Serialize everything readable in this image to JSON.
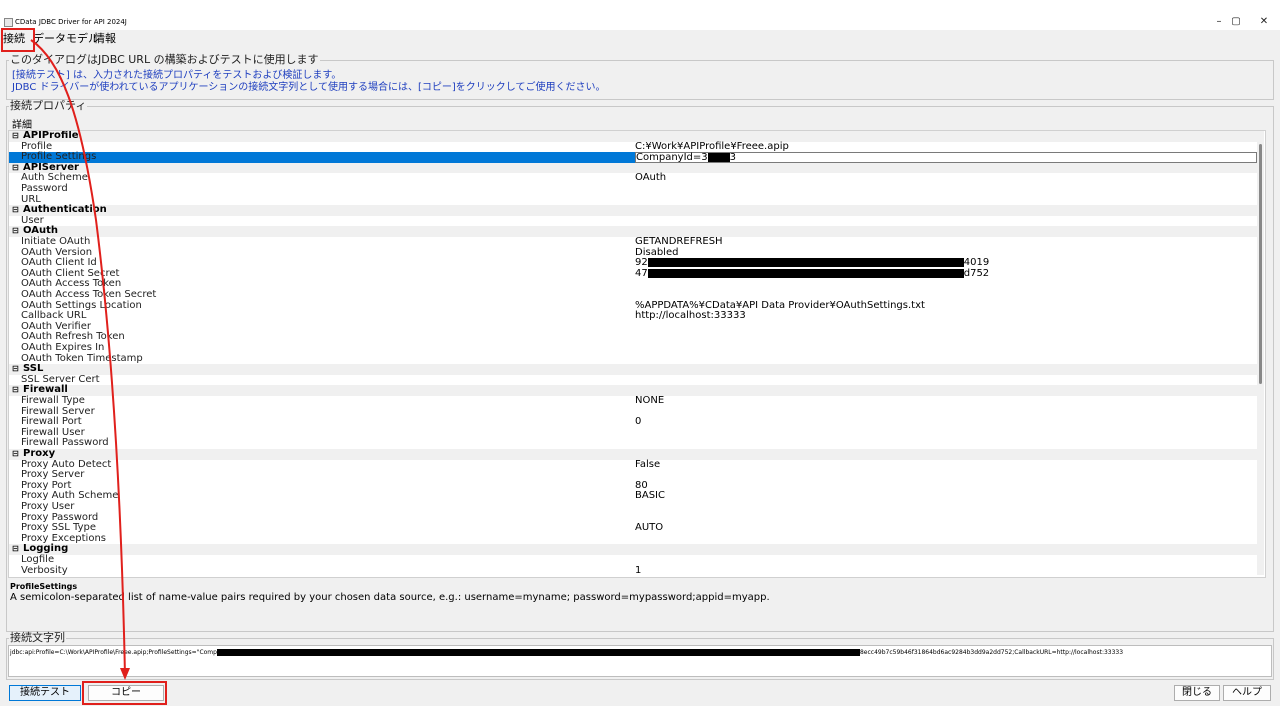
{
  "window": {
    "title": "CData JDBC Driver for API 2024J",
    "controls": {
      "minimize": "–",
      "maximize": "▢",
      "close": "✕"
    }
  },
  "menu": {
    "items": [
      "接続",
      "データモデル",
      "情報"
    ]
  },
  "intro": {
    "legend": "このダイアログはJDBC URL の構築およびテストに使用します",
    "line1": "[接続テスト] は、入力された接続プロパティをテストおよび検証します。",
    "line2": "JDBC ドライバーが使われているアプリケーションの接続文字列として使用する場合には、[コピー]をクリックしてご使用ください。"
  },
  "properties": {
    "legend": "接続プロパティ",
    "details_label": "詳細",
    "rows": [
      {
        "type": "cat",
        "label": "APIProfile"
      },
      {
        "type": "prop",
        "label": "Profile",
        "value": "C:¥Work¥APIProfile¥Freee.apip"
      },
      {
        "type": "prop",
        "label": "Profile Settings",
        "value": "CompanyId=3",
        "value_tail": "3",
        "redact": [
          [
            64,
            22
          ]
        ],
        "selected": true
      },
      {
        "type": "cat",
        "label": "APIServer"
      },
      {
        "type": "prop",
        "label": "Auth Scheme",
        "value": "OAuth"
      },
      {
        "type": "prop",
        "label": "Password",
        "value": ""
      },
      {
        "type": "prop",
        "label": "URL",
        "value": ""
      },
      {
        "type": "cat",
        "label": "Authentication"
      },
      {
        "type": "prop",
        "label": "User",
        "value": ""
      },
      {
        "type": "cat",
        "label": "OAuth"
      },
      {
        "type": "prop",
        "label": "Initiate OAuth",
        "value": "GETANDREFRESH"
      },
      {
        "type": "prop",
        "label": "OAuth Version",
        "value": "Disabled"
      },
      {
        "type": "prop",
        "label": "OAuth Client Id",
        "value": "92",
        "value_tail": "4019",
        "redact": [
          [
            18,
            316
          ]
        ]
      },
      {
        "type": "prop",
        "label": "OAuth Client Secret",
        "value": "47",
        "value_tail": "d752",
        "redact": [
          [
            18,
            316
          ]
        ]
      },
      {
        "type": "prop",
        "label": "OAuth Access Token",
        "value": ""
      },
      {
        "type": "prop",
        "label": "OAuth Access Token Secret",
        "value": ""
      },
      {
        "type": "prop",
        "label": "OAuth Settings Location",
        "value": "%APPDATA%¥CData¥API Data Provider¥OAuthSettings.txt"
      },
      {
        "type": "prop",
        "label": "Callback URL",
        "value": "http://localhost:33333"
      },
      {
        "type": "prop",
        "label": "OAuth Verifier",
        "value": ""
      },
      {
        "type": "prop",
        "label": "OAuth Refresh Token",
        "value": ""
      },
      {
        "type": "prop",
        "label": "OAuth Expires In",
        "value": ""
      },
      {
        "type": "prop",
        "label": "OAuth Token Timestamp",
        "value": ""
      },
      {
        "type": "cat",
        "label": "SSL"
      },
      {
        "type": "prop",
        "label": "SSL Server Cert",
        "value": ""
      },
      {
        "type": "cat",
        "label": "Firewall"
      },
      {
        "type": "prop",
        "label": "Firewall Type",
        "value": "NONE"
      },
      {
        "type": "prop",
        "label": "Firewall Server",
        "value": ""
      },
      {
        "type": "prop",
        "label": "Firewall Port",
        "value": "0"
      },
      {
        "type": "prop",
        "label": "Firewall User",
        "value": ""
      },
      {
        "type": "prop",
        "label": "Firewall Password",
        "value": ""
      },
      {
        "type": "cat",
        "label": "Proxy"
      },
      {
        "type": "prop",
        "label": "Proxy Auto Detect",
        "value": "False"
      },
      {
        "type": "prop",
        "label": "Proxy Server",
        "value": ""
      },
      {
        "type": "prop",
        "label": "Proxy Port",
        "value": "80"
      },
      {
        "type": "prop",
        "label": "Proxy Auth Scheme",
        "value": "BASIC"
      },
      {
        "type": "prop",
        "label": "Proxy User",
        "value": ""
      },
      {
        "type": "prop",
        "label": "Proxy Password",
        "value": ""
      },
      {
        "type": "prop",
        "label": "Proxy SSL Type",
        "value": "AUTO"
      },
      {
        "type": "prop",
        "label": "Proxy Exceptions",
        "value": ""
      },
      {
        "type": "cat",
        "label": "Logging"
      },
      {
        "type": "prop",
        "label": "Logfile",
        "value": ""
      },
      {
        "type": "prop",
        "label": "Verbosity",
        "value": "1"
      }
    ]
  },
  "help": {
    "title": "ProfileSettings",
    "description": "A semicolon-separated list of name-value pairs required by your chosen data source, e.g.: username=myname; password=mypassword;appid=myapp."
  },
  "connection_string": {
    "legend": "接続文字列",
    "prefix": "jdbc:api:Profile=C:\\Work\\APIProfile\\Freee.apip;ProfileSettings=\"Comp",
    "suffix": "8ecc49b7c59b46f31864bd6ac9284b3dd9a2dd752;CallbackURL=http://localhost:33333"
  },
  "buttons": {
    "test": "接続テスト",
    "copy": "コピー",
    "close": "閉じる",
    "help": "ヘルプ"
  },
  "colors": {
    "annotation_red": "#e0201c",
    "selection_blue": "#0078d7",
    "info_text": "#1f3fbf"
  }
}
